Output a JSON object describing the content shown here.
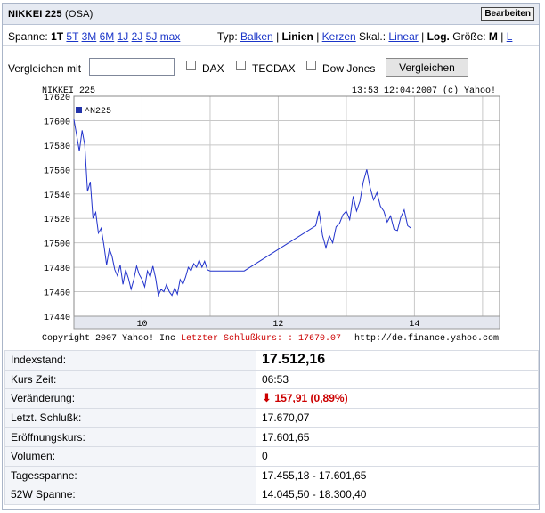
{
  "header": {
    "title": "NIKKEI 225",
    "exchange": "(OSA)",
    "edit_label": "Bearbeiten"
  },
  "spanne": {
    "label": "Spanne:",
    "items": [
      {
        "label": "1T",
        "selected": true
      },
      {
        "label": "5T"
      },
      {
        "label": "3M"
      },
      {
        "label": "6M"
      },
      {
        "label": "1J"
      },
      {
        "label": "2J"
      },
      {
        "label": "5J"
      },
      {
        "label": "max"
      }
    ]
  },
  "typ": {
    "label": "Typ:",
    "balken": "Balken",
    "linien": "Linien",
    "kerzen": "Kerzen"
  },
  "skal": {
    "label": "Skal.:",
    "linear": "Linear",
    "log": "Log."
  },
  "groesse": {
    "label": "Größe:",
    "m": "M",
    "l": "L"
  },
  "compare": {
    "label": "Vergleichen mit",
    "input_value": "",
    "options": [
      "DAX",
      "TECDAX",
      "Dow Jones"
    ],
    "button": "Vergleichen"
  },
  "chart_header": {
    "left": "NIKKEI 225",
    "right": "13:53 12:04:2007 (c) Yahoo!"
  },
  "chart_footer": {
    "left": "Copyright 2007 Yahoo! Inc",
    "middle": "Letzter Schlußkurs: : 17670.07",
    "right": "http://de.finance.yahoo.com"
  },
  "chart_data": {
    "type": "line",
    "title": "NIKKEI 225",
    "legend": "^N225",
    "ylim": [
      17440,
      17620
    ],
    "yticks": [
      17440,
      17460,
      17480,
      17500,
      17520,
      17540,
      17560,
      17580,
      17600,
      17620
    ],
    "xlim": [
      9.0,
      15.25
    ],
    "xticks": [
      10,
      12,
      14
    ],
    "xticklabels": [
      "10",
      "12",
      "14"
    ],
    "reference_line": 17670.07,
    "grid": true,
    "x": [
      9.0,
      9.04,
      9.08,
      9.12,
      9.16,
      9.2,
      9.24,
      9.28,
      9.32,
      9.36,
      9.4,
      9.44,
      9.48,
      9.52,
      9.56,
      9.6,
      9.64,
      9.68,
      9.72,
      9.76,
      9.8,
      9.84,
      9.88,
      9.92,
      9.96,
      10.0,
      10.04,
      10.08,
      10.12,
      10.16,
      10.2,
      10.24,
      10.28,
      10.32,
      10.36,
      10.4,
      10.44,
      10.48,
      10.52,
      10.56,
      10.6,
      10.64,
      10.68,
      10.72,
      10.76,
      10.8,
      10.84,
      10.88,
      10.92,
      10.96,
      11.0,
      11.5,
      12.55,
      12.6,
      12.65,
      12.7,
      12.75,
      12.8,
      12.85,
      12.9,
      12.95,
      13.0,
      13.05,
      13.1,
      13.15,
      13.2,
      13.25,
      13.3,
      13.35,
      13.4,
      13.45,
      13.5,
      13.55,
      13.6,
      13.65,
      13.7,
      13.75,
      13.8,
      13.85,
      13.9,
      13.95
    ],
    "values": [
      17601,
      17588,
      17575,
      17592,
      17580,
      17542,
      17550,
      17520,
      17525,
      17508,
      17512,
      17498,
      17482,
      17495,
      17489,
      17478,
      17473,
      17482,
      17466,
      17478,
      17471,
      17462,
      17470,
      17481,
      17474,
      17470,
      17464,
      17477,
      17472,
      17481,
      17471,
      17457,
      17462,
      17460,
      17466,
      17460,
      17457,
      17463,
      17458,
      17470,
      17466,
      17472,
      17480,
      17477,
      17483,
      17480,
      17486,
      17480,
      17485,
      17478,
      17477,
      17477,
      17514,
      17526,
      17506,
      17496,
      17506,
      17500,
      17513,
      17516,
      17523,
      17526,
      17519,
      17538,
      17526,
      17534,
      17550,
      17560,
      17545,
      17535,
      17541,
      17530,
      17526,
      17517,
      17522,
      17511,
      17510,
      17521,
      17527,
      17514,
      17512
    ]
  },
  "info_table": [
    {
      "key": "Indexstand:",
      "value": "17.512,16",
      "style": "big"
    },
    {
      "key": "Kurs Zeit:",
      "value": "06:53",
      "style": ""
    },
    {
      "key": "Veränderung:",
      "value": "157,91 (0,89%)",
      "style": "neg",
      "arrow": "down"
    },
    {
      "key": "Letzt. Schlußk:",
      "value": "17.670,07",
      "style": ""
    },
    {
      "key": "Eröffnungskurs:",
      "value": "17.601,65",
      "style": ""
    },
    {
      "key": "Volumen:",
      "value": "0",
      "style": ""
    },
    {
      "key": "Tagesspanne:",
      "value": "17.455,18 - 17.601,65",
      "style": ""
    },
    {
      "key": "52W Spanne:",
      "value": "14.045,50 - 18.300,40",
      "style": ""
    }
  ],
  "colors": {
    "line": "#2233cc",
    "header_bg": "#e6eaf2",
    "link": "#1a35c8",
    "negative": "#cc0000",
    "footer_red": "#cc0000"
  }
}
